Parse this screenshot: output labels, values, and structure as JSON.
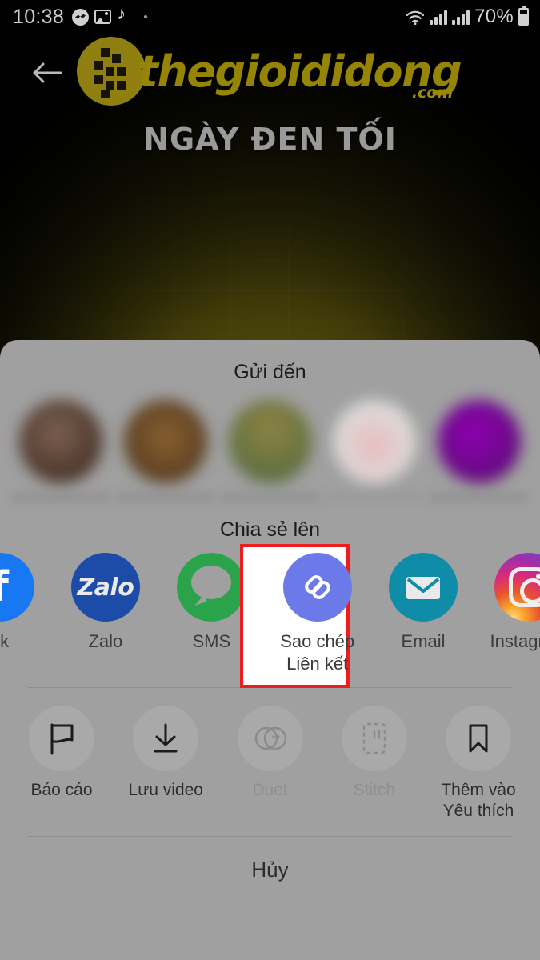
{
  "status_bar": {
    "time": "10:38",
    "icons": [
      "messenger-icon",
      "photo-icon",
      "tiktok-icon"
    ],
    "battery_text": "70%",
    "right_icons": [
      "wifi-icon",
      "signal-icon",
      "signal-icon",
      "battery-icon"
    ]
  },
  "video": {
    "back_icon": "back-arrow-icon",
    "brand_name": "thegioididong",
    "brand_suffix": ".com",
    "headline": "NGÀY ĐEN TỐI"
  },
  "sheet": {
    "send_to_title": "Gửi đến",
    "contacts": [
      {
        "color": "#5a4234",
        "name_blur": true
      },
      {
        "color": "#6b4c28",
        "name_blur": true
      },
      {
        "color": "#6d6634",
        "name_blur": true
      },
      {
        "color": "#d8b6b4",
        "name_blur": true
      },
      {
        "color": "#7a1490",
        "name_blur": true
      }
    ],
    "share_to_title": "Chia sẻ lên",
    "apps": [
      {
        "label": "ok",
        "icon": "facebook-icon",
        "color": "#1877f2",
        "partial": true
      },
      {
        "label": "Zalo",
        "icon": "zalo-icon",
        "color": "#1d4ba8"
      },
      {
        "label": "SMS",
        "icon": "sms-icon",
        "color": "#2aa34a"
      },
      {
        "label": "Sao chép\nLiên kết",
        "label_line1": "Sao chép",
        "label_line2": "Liên kết",
        "icon": "copy-link-icon",
        "color": "#6b7ae8",
        "highlighted": true
      },
      {
        "label": "Email",
        "icon": "email-icon",
        "color": "#0e8ca8"
      },
      {
        "label": "Instagram",
        "icon": "instagram-icon",
        "color": "#d92b7b",
        "partial": true
      }
    ],
    "actions": [
      {
        "label": "Báo cáo",
        "icon": "flag-icon",
        "disabled": false
      },
      {
        "label": "Lưu video",
        "icon": "download-icon",
        "disabled": false
      },
      {
        "label": "Duet",
        "icon": "duet-icon",
        "disabled": true
      },
      {
        "label": "Stitch",
        "icon": "stitch-icon",
        "disabled": true
      },
      {
        "label": "Thêm vào",
        "label_line2": "Yêu thích",
        "icon": "bookmark-icon",
        "disabled": false
      }
    ],
    "cancel_label": "Hủy"
  },
  "colors": {
    "sheet_bg": "#a0a0a0",
    "highlight_border": "#ee1d1d",
    "highlight_fill": "#ffffff",
    "brand_gold": "#968504"
  }
}
